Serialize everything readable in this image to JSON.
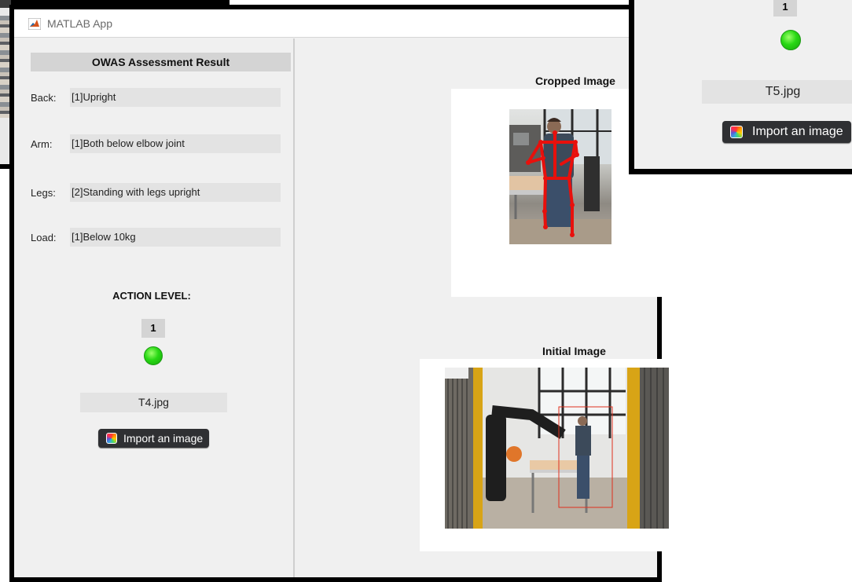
{
  "window": {
    "title": "MATLAB App"
  },
  "result_panel": {
    "header": "OWAS Assessment Result",
    "rows": [
      {
        "label": "Back:",
        "value": "[1]Upright"
      },
      {
        "label": "Arm:",
        "value": "[1]Both below elbow joint"
      },
      {
        "label": "Legs:",
        "value": "[2]Standing with legs upright"
      },
      {
        "label": "Load:",
        "value": "[1]Below 10kg"
      }
    ],
    "action_title": "ACTION LEVEL:",
    "action_level": "1",
    "lamp_color": "#22d40f",
    "filename": "T4.jpg",
    "import_label": "Import an image"
  },
  "images": {
    "cropped_title": "Cropped Image",
    "initial_title": "Initial Image",
    "skeleton_color": "#e8100c",
    "bbox_color": "#e0301e"
  },
  "overlay": {
    "action_level": "1",
    "filename": "T5.jpg",
    "import_label": "Import an image"
  }
}
